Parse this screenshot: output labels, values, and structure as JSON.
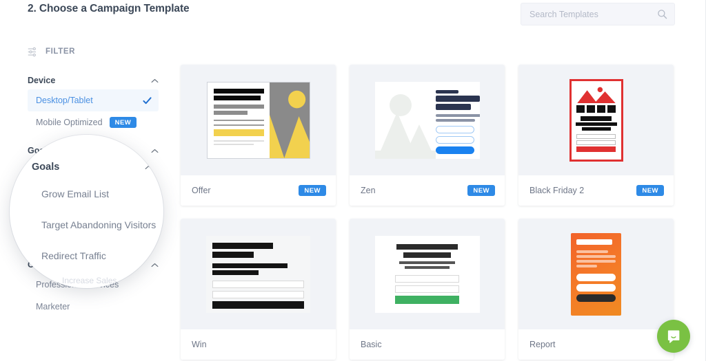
{
  "header": {
    "title": "2. Choose a Campaign Template",
    "search": {
      "placeholder": "Search Templates",
      "value": "",
      "icon": "search-icon"
    }
  },
  "sidebar": {
    "filter_label": "FILTER",
    "filter_icon": "sliders-filter-icon",
    "groups": [
      {
        "title": "Device",
        "collapse_icon": "chevron-up-icon",
        "options": [
          {
            "label": "Desktop/Tablet",
            "selected": true,
            "check_icon": "check-icon",
            "badge": ""
          },
          {
            "label": "Mobile Optimized",
            "selected": false,
            "badge": "NEW"
          }
        ]
      },
      {
        "title": "Goals",
        "collapse_icon": "chevron-up-icon",
        "options": [
          {
            "label": "Grow Email List",
            "selected": false,
            "badge": ""
          },
          {
            "label": "Target Abandoning Visitors",
            "selected": false,
            "badge": ""
          },
          {
            "label": "Redirect Traffic",
            "selected": false,
            "badge": ""
          },
          {
            "label": "Increase Sales",
            "selected": false,
            "badge": ""
          }
        ]
      },
      {
        "title": "Categories",
        "collapse_icon": "chevron-up-icon",
        "options": [
          {
            "label": "Professional Services",
            "selected": false,
            "badge": ""
          },
          {
            "label": "Marketer",
            "selected": false,
            "badge": ""
          }
        ]
      }
    ]
  },
  "magnifier": {
    "group_title": "Goals",
    "collapse_icon": "chevron-up-icon",
    "options": [
      {
        "label": "Grow Email List"
      },
      {
        "label": "Target Abandoning Visitors"
      },
      {
        "label": "Redirect Traffic"
      }
    ],
    "partial_label": "Increase Sales"
  },
  "templates": [
    {
      "name": "Offer",
      "badge": "NEW",
      "style": "offer"
    },
    {
      "name": "Zen",
      "badge": "NEW",
      "style": "zen"
    },
    {
      "name": "Black Friday 2",
      "badge": "NEW",
      "style": "blackfriday"
    },
    {
      "name": "Win",
      "badge": "",
      "style": "win"
    },
    {
      "name": "Basic",
      "badge": "",
      "style": "basic"
    },
    {
      "name": "Report",
      "badge": "",
      "style": "report"
    }
  ],
  "chat": {
    "icon": "chat-bubble-icon",
    "color": "#7ac143"
  },
  "colors": {
    "accent_blue": "#2e8ae6",
    "link_blue": "#4a90e2",
    "title": "#3c4858",
    "muted": "#7a8394",
    "offer_yellow": "#f2d14e",
    "blackfriday_red": "#e03131",
    "basic_green": "#3fb162",
    "report_orange": "#f2622a",
    "chat_green": "#7ac143"
  }
}
